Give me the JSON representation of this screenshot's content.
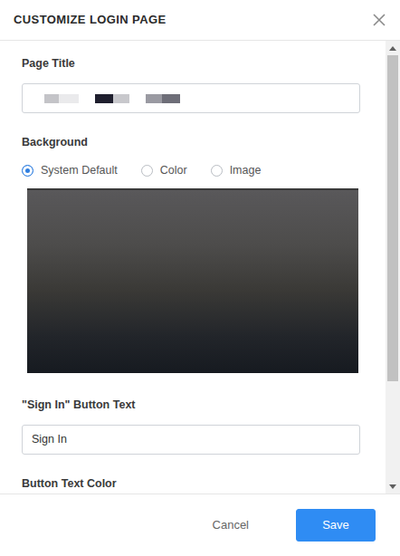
{
  "dialog": {
    "title": "CUSTOMIZE LOGIN PAGE"
  },
  "page_title": {
    "label": "Page Title"
  },
  "background": {
    "label": "Background",
    "options": [
      {
        "label": "System Default",
        "selected": true
      },
      {
        "label": "Color",
        "selected": false
      },
      {
        "label": "Image",
        "selected": false
      }
    ]
  },
  "sign_in": {
    "label": "\"Sign In\" Button Text",
    "value": "Sign In"
  },
  "button_text_color": {
    "label": "Button Text Color"
  },
  "buttons": [
    {
      "label": "Cancel",
      "kind": "secondary"
    },
    {
      "label": "Save",
      "kind": "primary"
    }
  ],
  "scrollbar": {
    "level": 0.77
  }
}
